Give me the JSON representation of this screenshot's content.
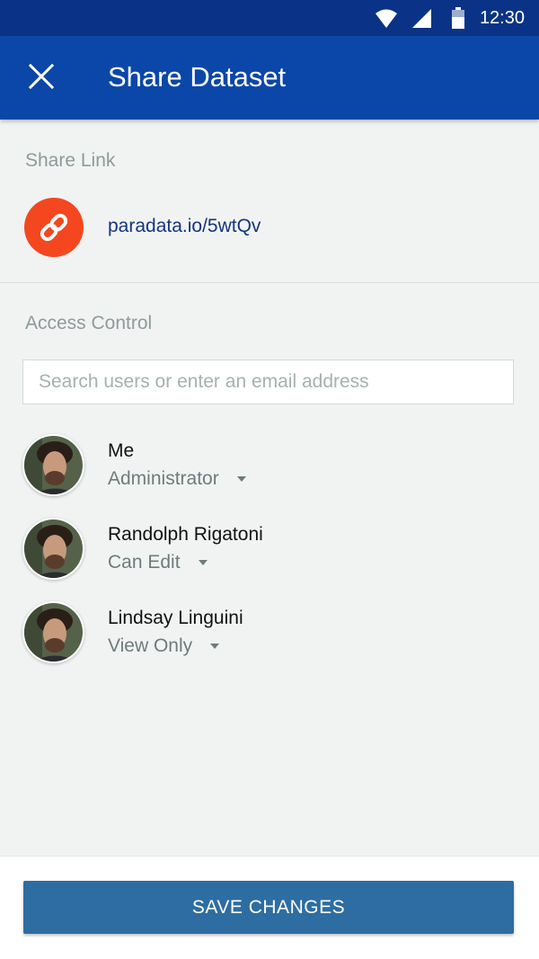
{
  "status_bar": {
    "time": "12:30",
    "icons": [
      "wifi-icon",
      "signal-icon",
      "battery-icon"
    ]
  },
  "app_bar": {
    "title": "Share Dataset",
    "close_icon": "close-icon"
  },
  "share_link": {
    "section_label": "Share Link",
    "icon": "link-icon",
    "url": "paradata.io/5wtQv"
  },
  "access_control": {
    "section_label": "Access Control",
    "search_placeholder": "Search users or enter an email address",
    "search_value": "",
    "users": [
      {
        "name": "Me",
        "role": "Administrator"
      },
      {
        "name": "Randolph Rigatoni",
        "role": "Can Edit"
      },
      {
        "name": "Lindsay Linguini",
        "role": "View Only"
      }
    ]
  },
  "footer": {
    "save_label": "SAVE CHANGES"
  },
  "colors": {
    "status_bar": "#0a3387",
    "app_bar": "#0b47a8",
    "background": "#f1f3f3",
    "link_icon": "#f4471f",
    "link_text": "#16357a",
    "save_button": "#2e6da1"
  }
}
